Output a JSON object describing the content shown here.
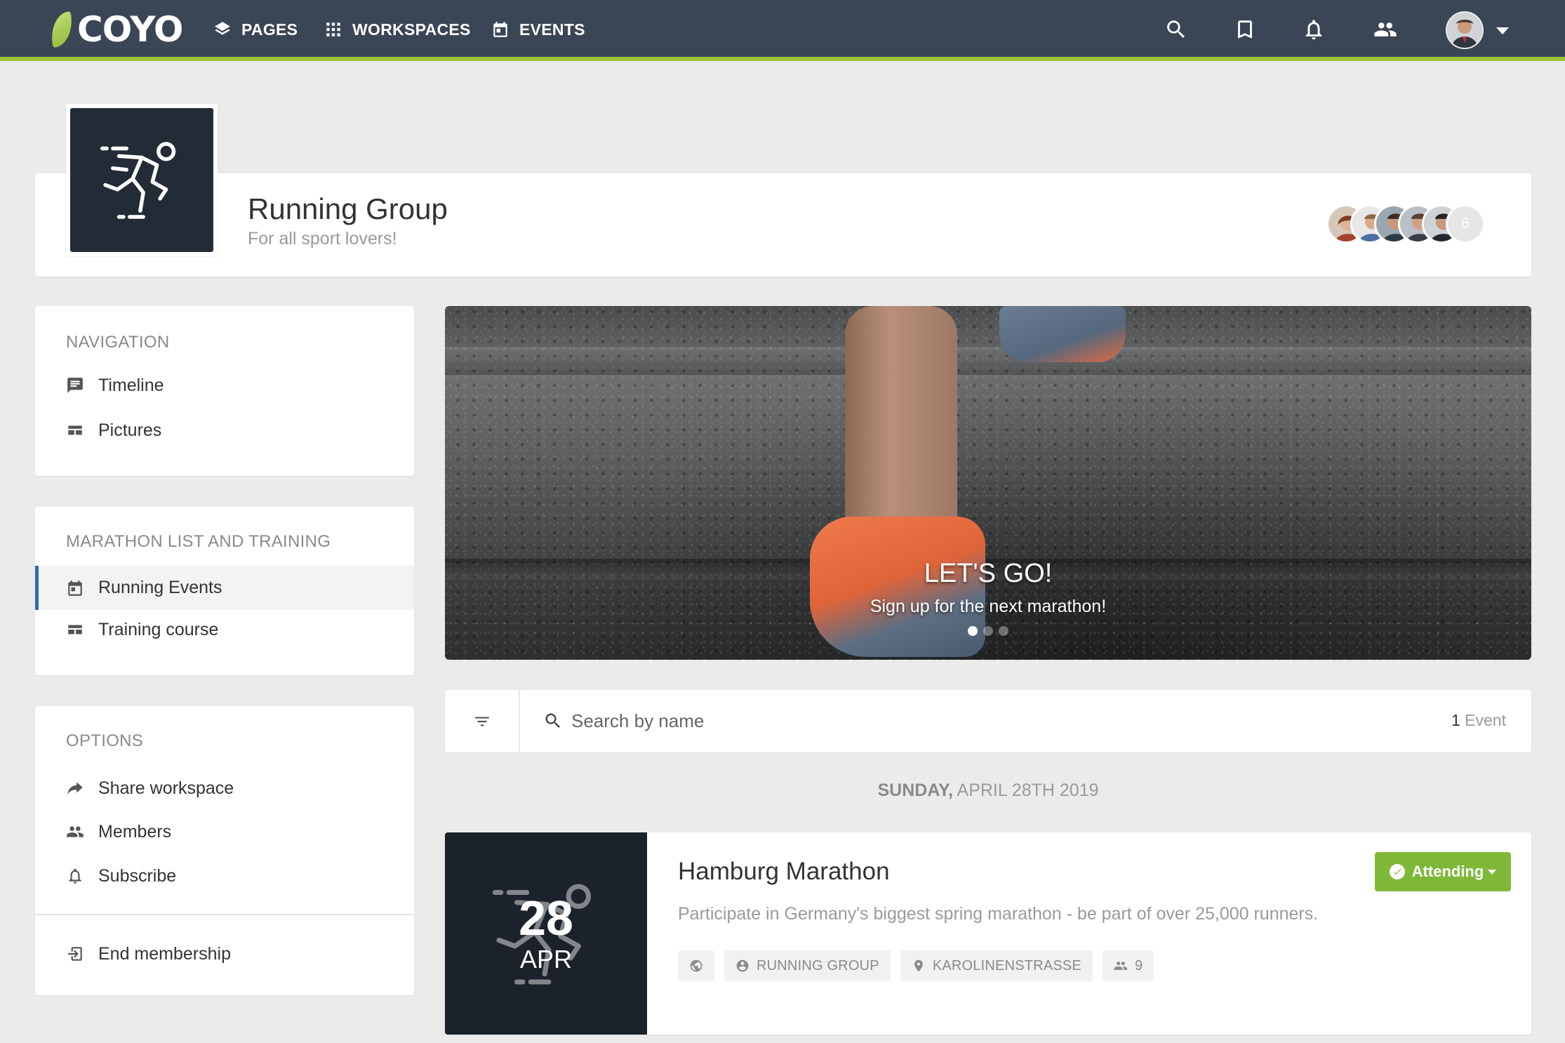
{
  "topbar": {
    "logo_text": "COYO",
    "nav": [
      {
        "label": "PAGES",
        "icon": "layers-icon"
      },
      {
        "label": "WORKSPACES",
        "icon": "grid-icon"
      },
      {
        "label": "EVENTS",
        "icon": "calendar-icon"
      }
    ],
    "accent_color": "#9bc53d",
    "bar_color": "#3a4556"
  },
  "workspace": {
    "title": "Running Group",
    "subtitle": "For all sport lovers!",
    "member_count": "6"
  },
  "sidebar": {
    "navigation": {
      "title": "NAVIGATION",
      "items": [
        {
          "label": "Timeline",
          "icon": "timeline-icon"
        },
        {
          "label": "Pictures",
          "icon": "pictures-icon"
        }
      ]
    },
    "marathon": {
      "title": "MARATHON LIST AND TRAINING",
      "items": [
        {
          "label": "Running Events",
          "icon": "calendar-icon",
          "active": true
        },
        {
          "label": "Training course",
          "icon": "pictures-icon"
        }
      ]
    },
    "options": {
      "title": "OPTIONS",
      "items": [
        {
          "label": "Share workspace",
          "icon": "share-icon"
        },
        {
          "label": "Members",
          "icon": "members-icon"
        },
        {
          "label": "Subscribe",
          "icon": "bell-icon"
        }
      ],
      "end_membership": "End membership"
    },
    "active_color": "#3a6aa8"
  },
  "hero": {
    "title": "LET'S GO!",
    "subtitle": "Sign up for the next marathon!",
    "slides": 3,
    "active_slide": 1
  },
  "search": {
    "placeholder": "Search by name",
    "count_number": "1",
    "count_label": "Event"
  },
  "date_heading": {
    "weekday": "SUNDAY,",
    "date": "APRIL 28TH 2019"
  },
  "event": {
    "day": "28",
    "month": "APR",
    "title": "Hamburg Marathon",
    "description": "Participate in Germany's biggest spring marathon - be part of over 25,000 runners.",
    "attend_label": "Attending",
    "attend_color": "#7fb837",
    "chips": {
      "group": "RUNNING GROUP",
      "location": "KAROLINENSTRASSE",
      "attendees": "9"
    }
  }
}
